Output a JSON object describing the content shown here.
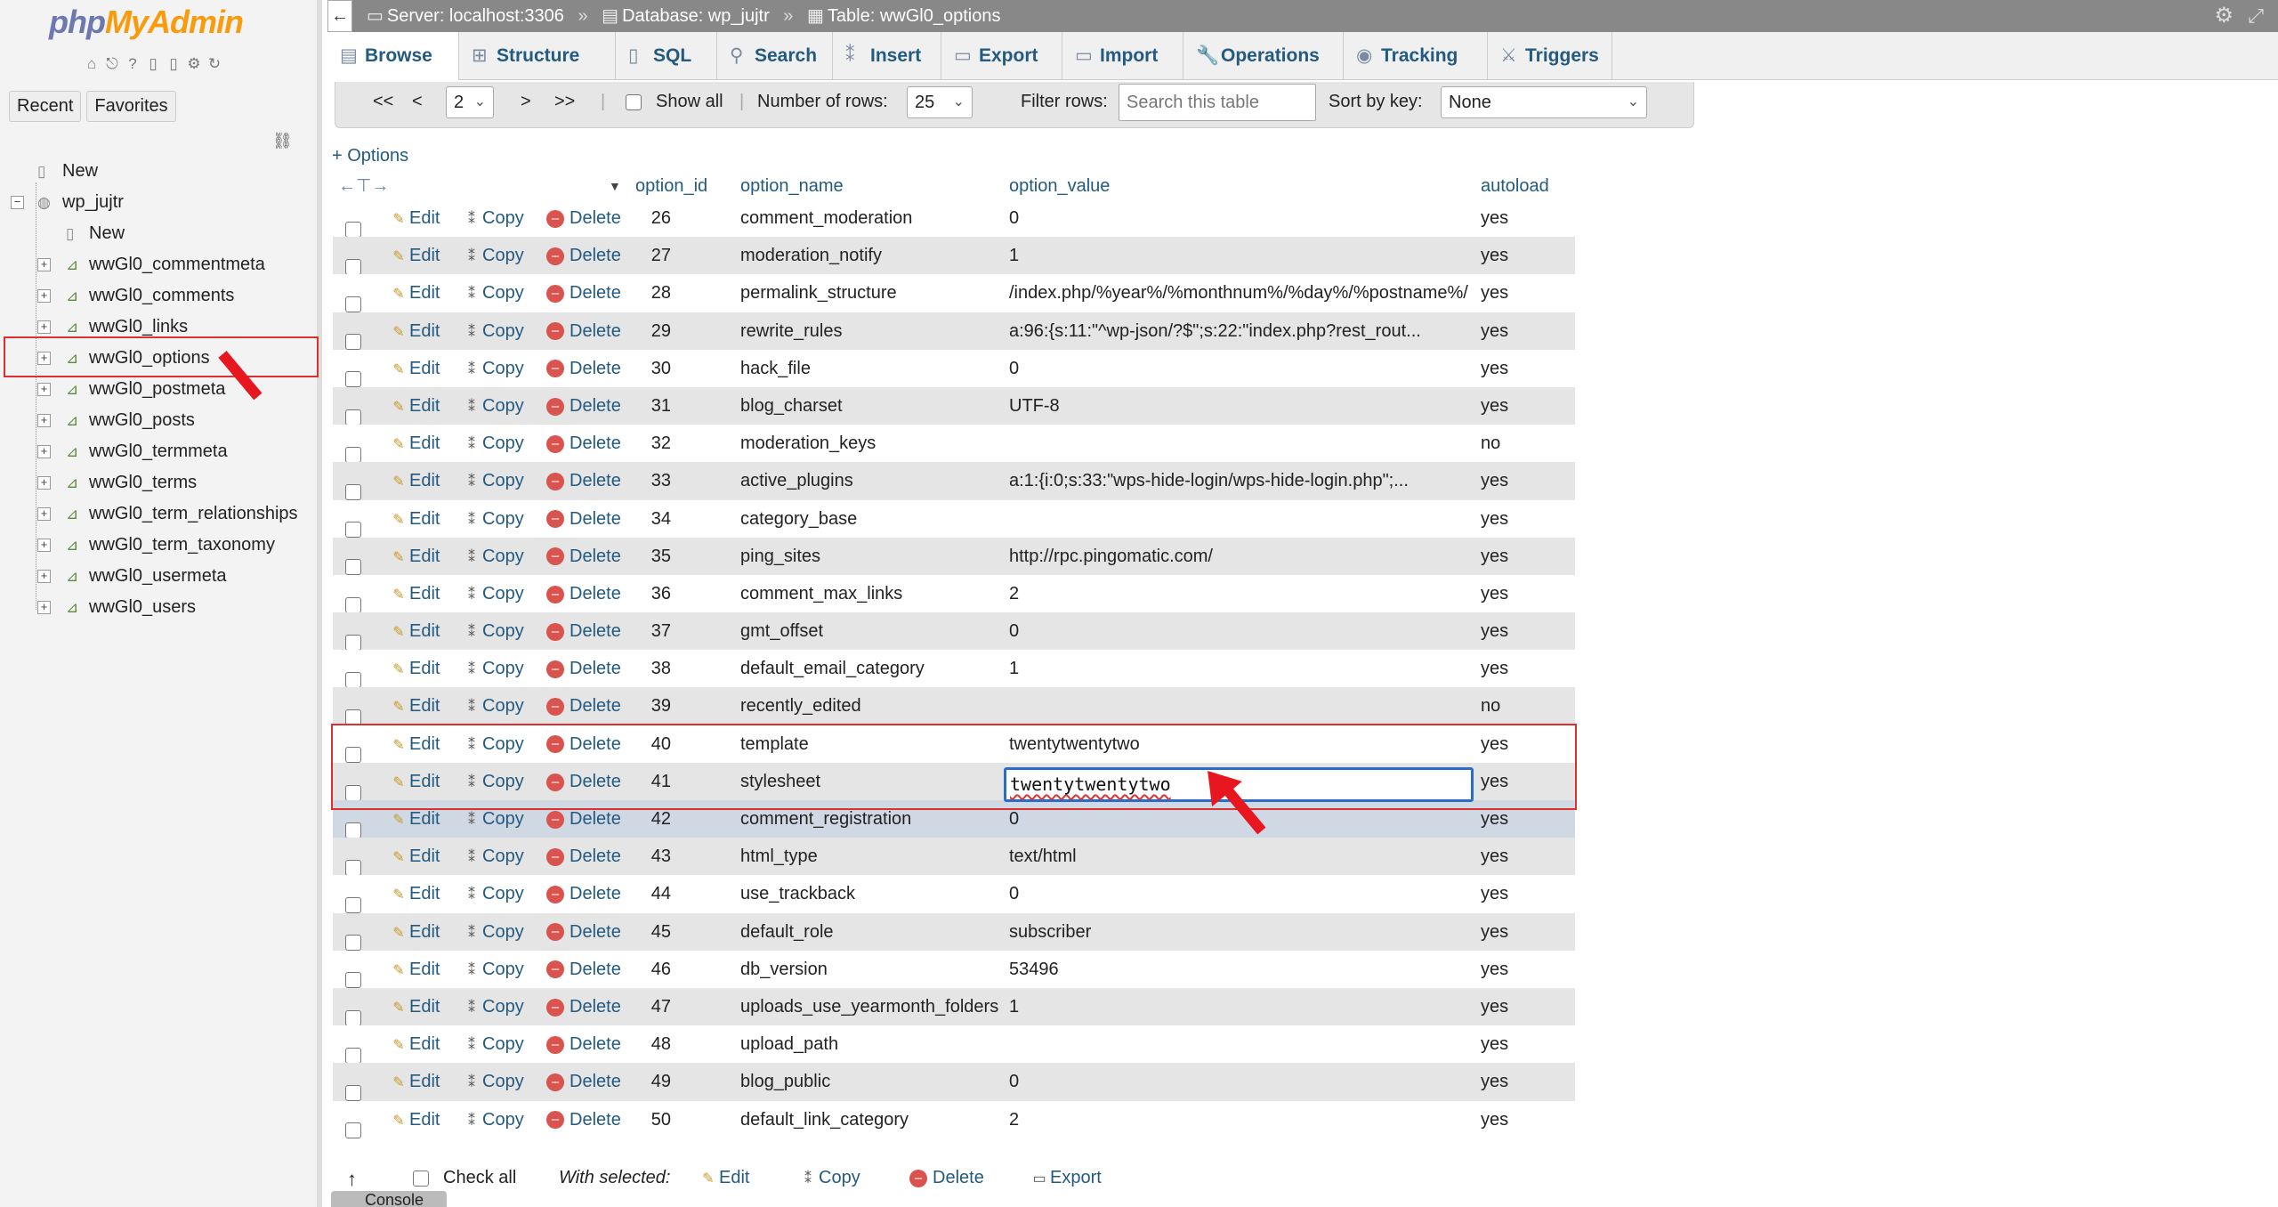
{
  "nav": {
    "logo_php": "php",
    "logo_myadmin": "MyAdmin",
    "tabs": [
      "Recent",
      "Favorites"
    ],
    "tree": [
      {
        "kind": "top",
        "label": "New"
      },
      {
        "kind": "db",
        "label": "wp_jujtr"
      },
      {
        "kind": "newt",
        "label": "New"
      },
      {
        "kind": "tbl",
        "label": "wwGl0_commentmeta"
      },
      {
        "kind": "tbl",
        "label": "wwGl0_comments"
      },
      {
        "kind": "tbl",
        "label": "wwGl0_links"
      },
      {
        "kind": "tbl",
        "label": "wwGl0_options"
      },
      {
        "kind": "tbl",
        "label": "wwGl0_postmeta"
      },
      {
        "kind": "tbl",
        "label": "wwGl0_posts"
      },
      {
        "kind": "tbl",
        "label": "wwGl0_termmeta"
      },
      {
        "kind": "tbl",
        "label": "wwGl0_terms"
      },
      {
        "kind": "tbl",
        "label": "wwGl0_term_relationships"
      },
      {
        "kind": "tbl",
        "label": "wwGl0_term_taxonomy"
      },
      {
        "kind": "tbl",
        "label": "wwGl0_usermeta"
      },
      {
        "kind": "tbl",
        "label": "wwGl0_users"
      }
    ]
  },
  "breadcrumb": {
    "server": "Server: localhost:3306",
    "database": "Database: wp_jujtr",
    "table": "Table: wwGl0_options"
  },
  "menu": [
    "Browse",
    "Structure",
    "SQL",
    "Search",
    "Insert",
    "Export",
    "Import",
    "Operations",
    "Tracking",
    "Triggers"
  ],
  "pager": {
    "first": "<<",
    "prev": "<",
    "page": "2",
    "next": ">",
    "last": ">>",
    "show_all": "Show all",
    "rows_label": "Number of rows:",
    "rows_value": "25",
    "filter_label": "Filter rows:",
    "filter_placeholder": "Search this table",
    "sort_label": "Sort by key:",
    "sort_value": "None"
  },
  "options_link": "+ Options",
  "columns": [
    "option_id",
    "option_name",
    "option_value",
    "autoload"
  ],
  "actions": {
    "edit": "Edit",
    "copy": "Copy",
    "delete": "Delete"
  },
  "rows": [
    {
      "id": "26",
      "name": "comment_moderation",
      "value": "0",
      "autoload": "yes"
    },
    {
      "id": "27",
      "name": "moderation_notify",
      "value": "1",
      "autoload": "yes"
    },
    {
      "id": "28",
      "name": "permalink_structure",
      "value": "/index.php/%year%/%monthnum%/%day%/%postname%/",
      "autoload": "yes"
    },
    {
      "id": "29",
      "name": "rewrite_rules",
      "value": "a:96:{s:11:\"^wp-json/?$\";s:22:\"index.php?rest_rout...",
      "autoload": "yes"
    },
    {
      "id": "30",
      "name": "hack_file",
      "value": "0",
      "autoload": "yes"
    },
    {
      "id": "31",
      "name": "blog_charset",
      "value": "UTF-8",
      "autoload": "yes"
    },
    {
      "id": "32",
      "name": "moderation_keys",
      "value": "",
      "autoload": "no"
    },
    {
      "id": "33",
      "name": "active_plugins",
      "value": "a:1:{i:0;s:33:\"wps-hide-login/wps-hide-login.php\";...",
      "autoload": "yes"
    },
    {
      "id": "34",
      "name": "category_base",
      "value": "",
      "autoload": "yes"
    },
    {
      "id": "35",
      "name": "ping_sites",
      "value": "http://rpc.pingomatic.com/",
      "autoload": "yes"
    },
    {
      "id": "36",
      "name": "comment_max_links",
      "value": "2",
      "autoload": "yes"
    },
    {
      "id": "37",
      "name": "gmt_offset",
      "value": "0",
      "autoload": "yes"
    },
    {
      "id": "38",
      "name": "default_email_category",
      "value": "1",
      "autoload": "yes"
    },
    {
      "id": "39",
      "name": "recently_edited",
      "value": "",
      "autoload": "no"
    },
    {
      "id": "40",
      "name": "template",
      "value": "twentytwentytwo",
      "autoload": "yes"
    },
    {
      "id": "41",
      "name": "stylesheet",
      "value": "",
      "autoload": "yes"
    },
    {
      "id": "42",
      "name": "comment_registration",
      "value": "0",
      "autoload": "yes"
    },
    {
      "id": "43",
      "name": "html_type",
      "value": "text/html",
      "autoload": "yes"
    },
    {
      "id": "44",
      "name": "use_trackback",
      "value": "0",
      "autoload": "yes"
    },
    {
      "id": "45",
      "name": "default_role",
      "value": "subscriber",
      "autoload": "yes"
    },
    {
      "id": "46",
      "name": "db_version",
      "value": "53496",
      "autoload": "yes"
    },
    {
      "id": "47",
      "name": "uploads_use_yearmonth_folders",
      "value": "1",
      "autoload": "yes"
    },
    {
      "id": "48",
      "name": "upload_path",
      "value": "",
      "autoload": "yes"
    },
    {
      "id": "49",
      "name": "blog_public",
      "value": "0",
      "autoload": "yes"
    },
    {
      "id": "50",
      "name": "default_link_category",
      "value": "2",
      "autoload": "yes"
    }
  ],
  "edit_field_value": "twentytwentytwo",
  "bottom": {
    "check_all": "Check all",
    "with_selected": "With selected:",
    "edit": "Edit",
    "copy": "Copy",
    "delete": "Delete",
    "export": "Export"
  },
  "console": "Console",
  "colors": {
    "link": "#235a81",
    "accent_red": "#e8171f",
    "focus_blue": "#2a6cc9"
  }
}
